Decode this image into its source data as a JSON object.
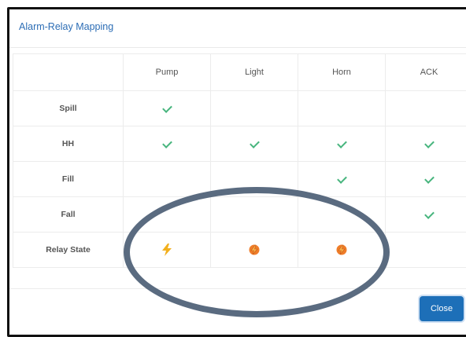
{
  "dialog": {
    "title": "Alarm-Relay Mapping",
    "close_label": "Close"
  },
  "table": {
    "columns": [
      "Pump",
      "Light",
      "Horn",
      "ACK"
    ],
    "rows": [
      {
        "label": "Spill",
        "cells": [
          "check",
          "",
          "",
          ""
        ]
      },
      {
        "label": "HH",
        "cells": [
          "check",
          "check",
          "check",
          "check"
        ]
      },
      {
        "label": "Fill",
        "cells": [
          "",
          "",
          "check",
          "check"
        ]
      },
      {
        "label": "Fall",
        "cells": [
          "",
          "",
          "",
          "check"
        ]
      },
      {
        "label": "Relay State",
        "cells": [
          "bolt-icon",
          "bolt-circle-icon",
          "bolt-circle-icon",
          ""
        ]
      }
    ]
  },
  "colors": {
    "title": "#2c6db5",
    "check": "#48b57e",
    "bolt_yellow": "#f2b01e",
    "bolt_orange": "#ef7d2a",
    "button": "#1d6fb8",
    "annotation_oval": "#5a6b80"
  }
}
